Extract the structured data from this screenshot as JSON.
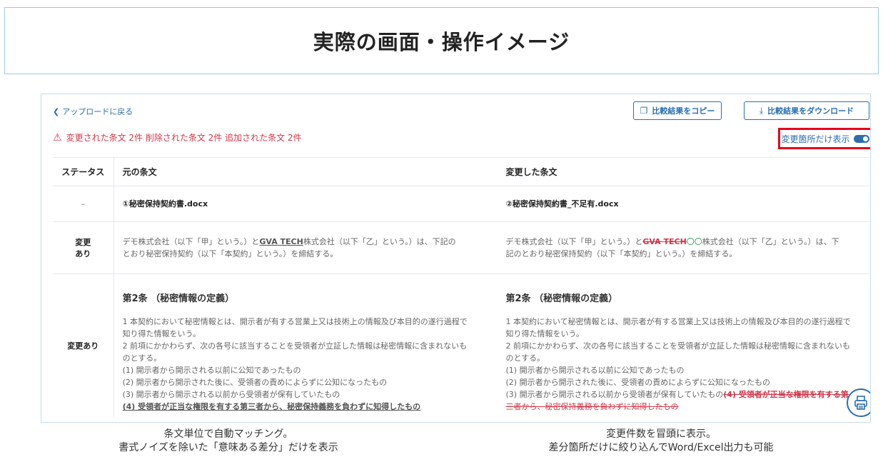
{
  "banner": {
    "title": "実際の画面・操作イメージ"
  },
  "toolbar": {
    "back_label": "アップロードに戻る",
    "copy_label": "比較結果をコピー",
    "download_label": "比較結果をダウンロード"
  },
  "summary": {
    "text": "変更された条文 2件 削除された条文 2件 追加された条文 2件"
  },
  "filter": {
    "label": "変更箇所だけ表示",
    "enabled": true
  },
  "table": {
    "headers": {
      "status": "ステータス",
      "original": "元の条文",
      "changed": "変更した条文"
    },
    "rows": {
      "files": {
        "status": "–",
        "original": "①秘密保持契約書.docx",
        "changed": "②秘密保持契約書_不足有.docx"
      },
      "intro": {
        "status_line1": "変更",
        "status_line2": "あり",
        "orig_pre": "デモ株式会社（以下「甲」という。）と",
        "orig_ins": "GVA TECH",
        "orig_post": "株式会社（以下「乙」という。）は、下記の",
        "orig_line2": "とおり秘密保持契約（以下「本契約」という。）を締結する。",
        "new_pre": "デモ株式会社（以下「甲」という。）と",
        "new_del": "GVA TECH",
        "new_add": "〇〇",
        "new_post": "株式会社（以下「乙」という。）は、下",
        "new_line2": "記のとおり秘密保持契約（以下「本契約」という。）を締結する。"
      },
      "article": {
        "status": "変更あり",
        "title": "第2条 （秘密情報の定義）",
        "l1a": "1 本契約において秘密情報とは、開示者が有する営業上又は技術上の情報及び本目的の遂行過程で",
        "l1b": "知り得た情報をいう。",
        "l2a": "2 前項にかかわらず、次の各号に該当することを受領者が立証した情報は秘密情報に含まれないも",
        "l2b": "のとする。",
        "i1": "(1) 開示者から開示される以前に公知であったもの",
        "i2": "(2) 開示者から開示された後に、受領者の責めによらずに公知になったもの",
        "i3": "(3) 開示者から開示される以前から受領者が保有していたもの",
        "i4": "(4) 受領者が正当な権限を有する第三者から、秘密保持義務を負わずに知得したもの",
        "new_del_a": "(4) 受領者が正当な権限を有する第",
        "new_del_b": "三者から、秘密保持義務を負わずに知得したもの"
      }
    }
  },
  "captions": {
    "left_line1": "条文単位で自動マッチング。",
    "left_line2": "書式ノイズを除いた「意味ある差分」だけを表示",
    "right_line1": "変更件数を冒頭に表示。",
    "right_line2": "差分箇所だけに絞り込んでWord/Excel出力も可能"
  },
  "colors": {
    "accent": "#2a6fb0",
    "deleted": "#d0384a",
    "added": "#2e9e5a",
    "highlight_box": "#e8001c"
  },
  "icons": [
    "chevron-left-icon",
    "copy-icon",
    "download-icon",
    "warning-icon",
    "toggle-switch",
    "print-icon"
  ]
}
